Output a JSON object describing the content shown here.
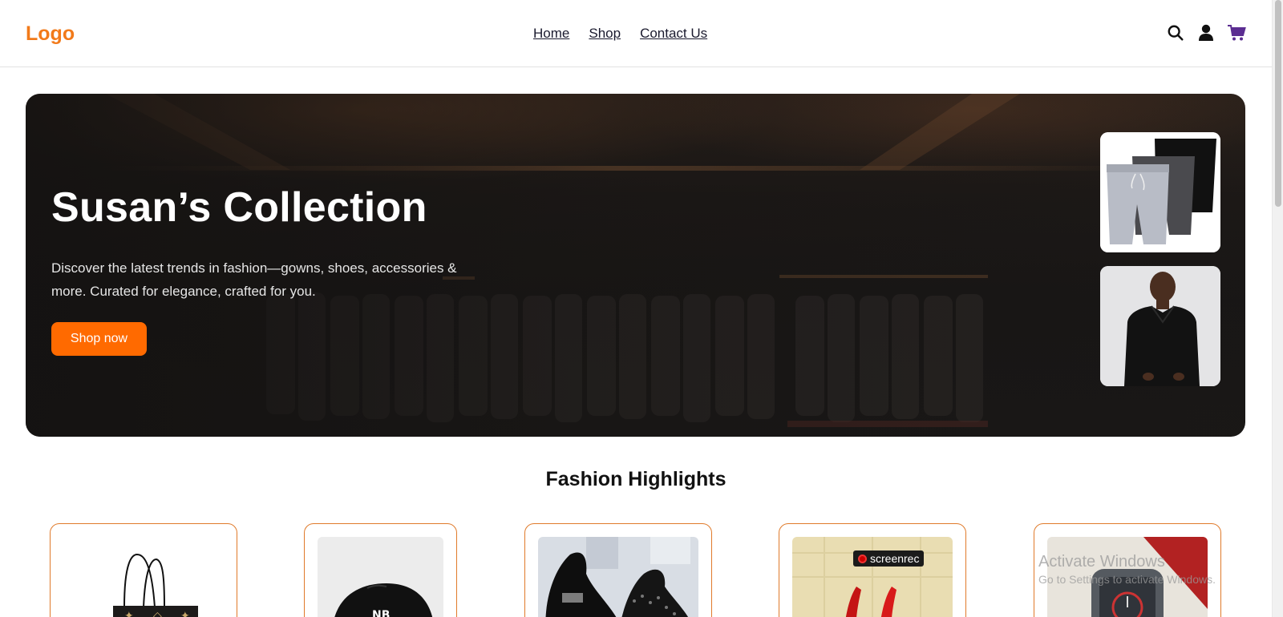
{
  "header": {
    "logo": "Logo",
    "nav": [
      "Home",
      "Shop",
      "Contact Us"
    ],
    "icons": [
      "search-icon",
      "user-icon",
      "cart-icon"
    ]
  },
  "hero": {
    "title": "Susan’s Collection",
    "description": "Discover the latest trends in fashion—gowns, shoes, accessories & more. Curated for elegance, crafted for you.",
    "cta_label": "Shop now",
    "thumbnails": [
      "shorts-image",
      "black-shirt-model-image"
    ]
  },
  "highlights": {
    "title": "Fashion Highlights",
    "products": [
      "handbag-image",
      "cap-image",
      "loafers-image",
      "red-heels-image",
      "watch-image"
    ]
  },
  "overlays": {
    "screenrec_label": "screenrec",
    "watermark_title": "Activate Windows",
    "watermark_sub": "Go to Settings to activate Windows."
  },
  "colors": {
    "brand_orange": "#f27a1a",
    "cta_orange": "#ff6a00",
    "cart_purple": "#5b2d91"
  }
}
